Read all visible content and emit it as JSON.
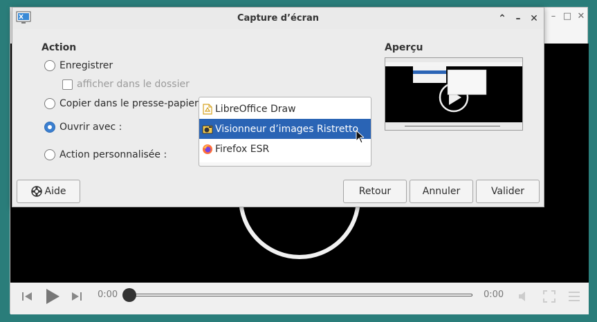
{
  "player": {
    "time_current": "0:00",
    "time_total": "0:00",
    "progress": 0
  },
  "dialog": {
    "title": "Capture d’écran",
    "icon": "screenshot-app-icon",
    "action": {
      "heading": "Action",
      "options": [
        {
          "label": "Enregistrer",
          "checked": false
        },
        {
          "label": "Copier dans le presse-papiers",
          "checked": false
        },
        {
          "label": "Ouvrir avec :",
          "checked": true
        },
        {
          "label": "Action personnalisée :",
          "checked": false
        }
      ],
      "show_in_folder": {
        "label": "afficher dans le dossier",
        "checked": false,
        "enabled": false
      }
    },
    "apps": [
      {
        "label": "LibreOffice Draw",
        "icon": "libreoffice-draw-icon",
        "selected": false
      },
      {
        "label": "Visionneur d’images Ristretto",
        "icon": "ristretto-icon",
        "selected": true
      },
      {
        "label": "Firefox ESR",
        "icon": "firefox-icon",
        "selected": false
      }
    ],
    "preview": {
      "heading": "Aperçu"
    },
    "buttons": {
      "help": "Aide",
      "back": "Retour",
      "cancel": "Annuler",
      "ok": "Valider"
    }
  },
  "colors": {
    "desktop": "#2a7d7a",
    "selection": "#2a64b5",
    "radio_checked": "#3b7fd0"
  }
}
